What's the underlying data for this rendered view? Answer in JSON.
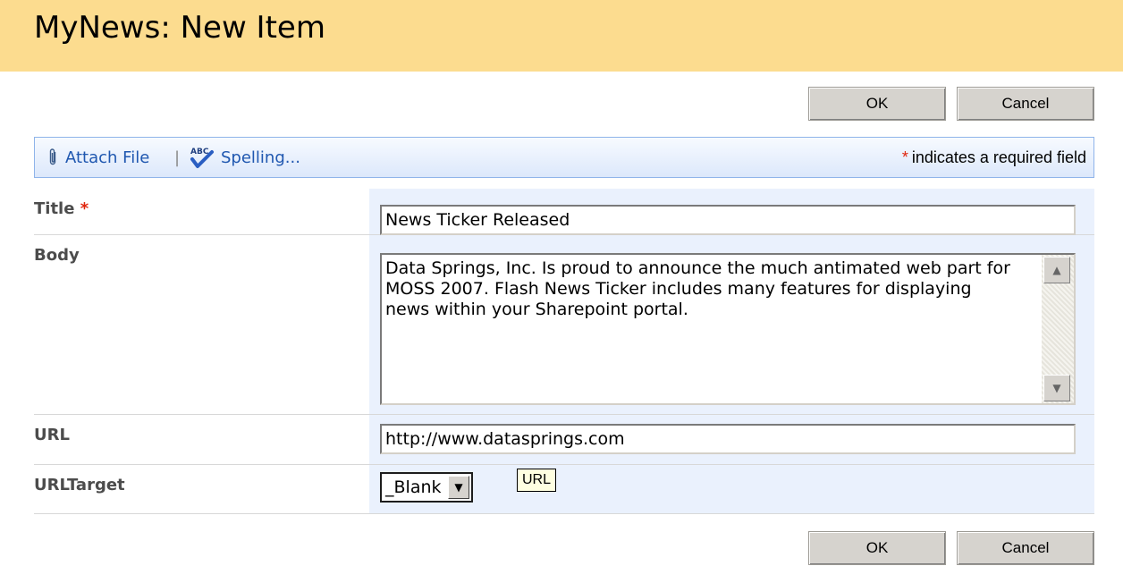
{
  "header": {
    "title": "MyNews: New Item"
  },
  "buttons": {
    "ok": "OK",
    "cancel": "Cancel"
  },
  "toolbar": {
    "attach": "Attach File",
    "separator": "|",
    "spelling": "Spelling...",
    "required_star": "*",
    "required_text": "indicates a required field"
  },
  "fields": {
    "title": {
      "label": "Title",
      "required": "*",
      "value": "News Ticker Released"
    },
    "body": {
      "label": "Body",
      "value": "Data Springs, Inc. Is proud to announce the much antimated web part for MOSS 2007. Flash News Ticker includes many features for displaying news within your Sharepoint portal."
    },
    "url": {
      "label": "URL",
      "value": "http://www.datasprings.com"
    },
    "urltarget": {
      "label": "URLTarget",
      "selected": "_Blank"
    }
  },
  "tooltip": {
    "text": "URL"
  },
  "colors": {
    "header_bg": "#fcdc8f",
    "field_bg": "#eaf1fd",
    "link": "#1f57b0",
    "required": "#e0250c"
  }
}
